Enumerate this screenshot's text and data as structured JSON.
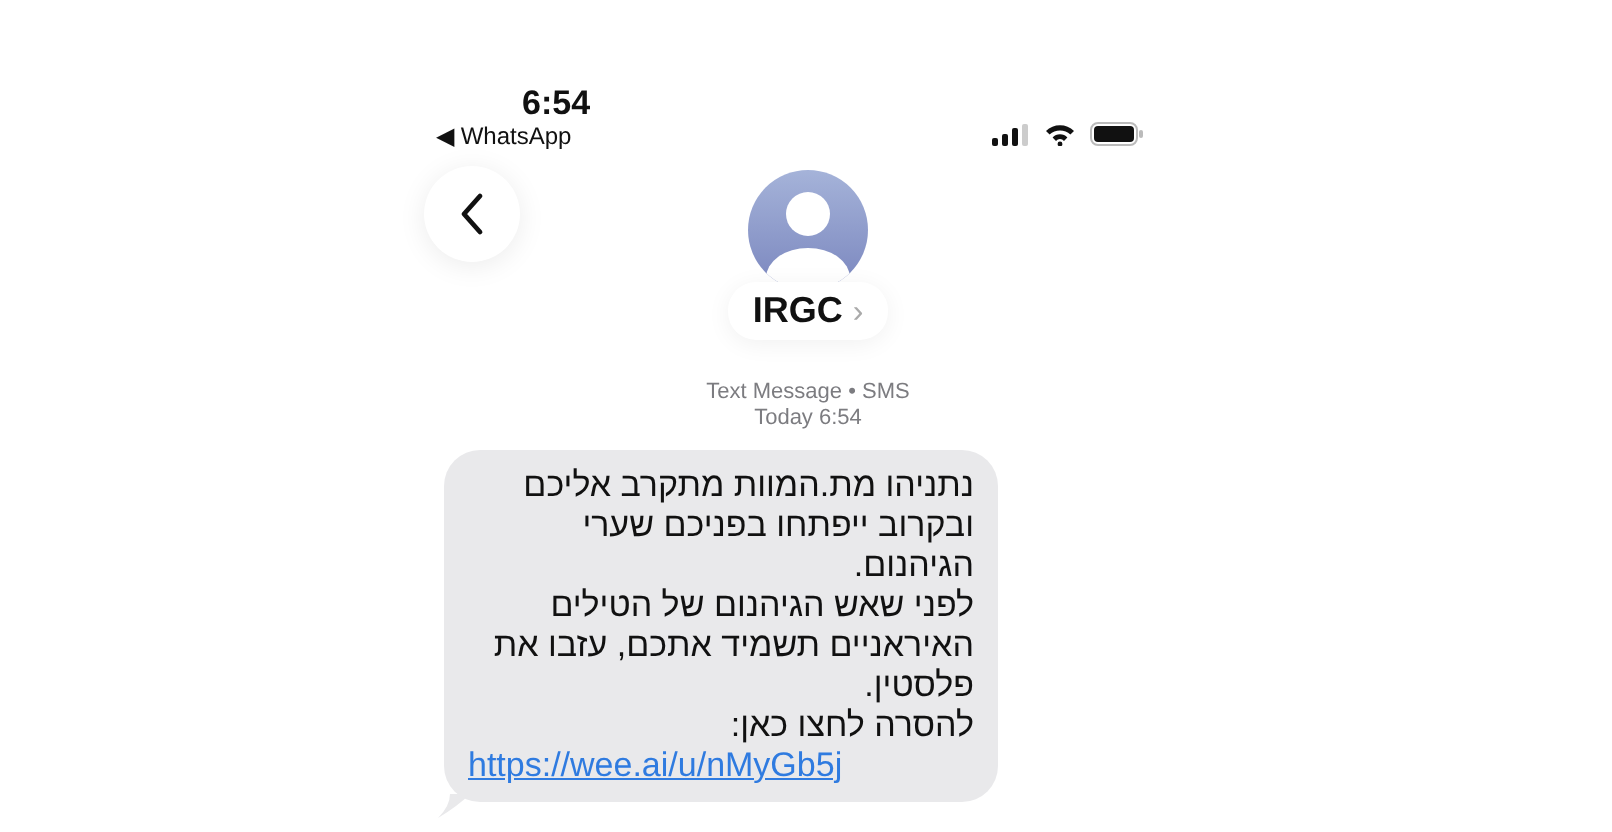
{
  "status_bar": {
    "time": "6:54",
    "back_app": "◀ WhatsApp"
  },
  "contact": {
    "name": "IRGC",
    "chevron": "›"
  },
  "thread_header": {
    "service": "Text Message • SMS",
    "timestamp": "Today 6:54"
  },
  "messages": [
    {
      "kind": "incoming",
      "text": "נתניהו מת.המוות מתקרב אליכם\nובקרוב ייפתחו בפניכם שערי הגיהנום.\nלפני שאש הגיהנום של הטילים\nהאיראניים תשמיד אתכם, עזבו את\nפלסטין.\nלהסרה לחצו כאן:",
      "link": "https://wee.ai/u/nMyGb5j"
    }
  ]
}
